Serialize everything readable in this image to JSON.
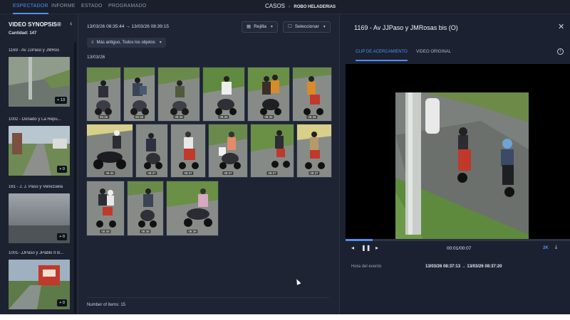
{
  "topbar": {
    "tabs": [
      {
        "label": "ESPECTADOR",
        "active": true
      },
      {
        "label": "INFORME",
        "active": false
      },
      {
        "label": "ESTADO",
        "active": false
      },
      {
        "label": "PROGRAMADO",
        "active": false
      }
    ],
    "breadcrumb": {
      "parent": "CASOS",
      "separator": "›",
      "current": "ROBO HELADERIAS"
    }
  },
  "sidebar": {
    "title": "VIDEO SYNOPSIS®",
    "count_label": "Cantidad: 147",
    "collapse_icon": "chevron-left-icon",
    "items": [
      {
        "label": "1169 - Av JJPaso y JMRos",
        "badge": "+ 13"
      },
      {
        "label": "1002 - Donado y La Repu...",
        "badge": "+ 0"
      },
      {
        "label": "161 - J. J. Paso y Venezuela",
        "badge": "+ 0"
      },
      {
        "label": "1001- JJPaso y JPablo II B...",
        "badge": "+ 0"
      }
    ]
  },
  "middle": {
    "range": "13/03/26 08:35:44  →  13/03/26 08:39:15",
    "view_button": "Rejilla",
    "select_button": "Seleccionar",
    "sort": "Más antiguo, Todos los objetos",
    "date_label": "13/03/26",
    "grid": [
      [
        "08:35",
        "08:35",
        "08:36",
        "08:36",
        "08:36",
        "08:36"
      ],
      [
        "08:36",
        "08:37",
        "08:37",
        "08:37",
        "08:37",
        "08:37"
      ],
      [
        "08:38",
        "08:38",
        "08:39"
      ]
    ],
    "items_count": "Number of items: 15"
  },
  "right": {
    "title": "1169 - Av JJPaso y JMRosas bis (O)",
    "tabs": [
      {
        "label": "CLIP DE ACERCAMIENTO",
        "active": true
      },
      {
        "label": "VIDEO ORIGINAL",
        "active": false
      }
    ],
    "playback": {
      "time": "00:01/00:07",
      "quality": "2K",
      "progress": 0.12
    },
    "event_label": "Hora del evento",
    "event_value": "13/03/26 08:37:13  →  13/03/26 08:37:20"
  },
  "colors": {
    "accent": "#4f8ff0",
    "background": "#1b2130",
    "panel": "#1e2433"
  }
}
